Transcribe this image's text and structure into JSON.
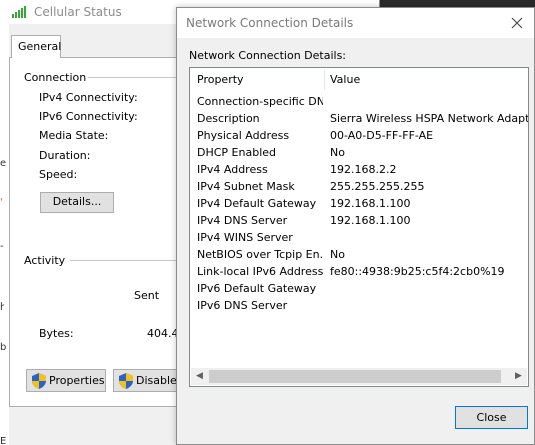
{
  "status_window": {
    "title": "Cellular Status",
    "tab": "General",
    "connection": {
      "group_label": "Connection",
      "fields": [
        "IPv4 Connectivity:",
        "IPv6 Connectivity:",
        "Media State:",
        "Duration:",
        "Speed:"
      ],
      "details_button": "Details..."
    },
    "activity": {
      "group_label": "Activity",
      "sent_label": "Sent",
      "bytes_label": "Bytes:",
      "bytes_sent": "404.4"
    },
    "properties_button": "Properties",
    "disable_button": "Disable"
  },
  "dialog": {
    "title": "Network Connection Details",
    "caption": "Network Connection Details:",
    "columns": {
      "property": "Property",
      "value": "Value"
    },
    "rows": [
      {
        "property": "Connection-specific DN...",
        "value": ""
      },
      {
        "property": "Description",
        "value": "Sierra Wireless HSPA Network Adapter #"
      },
      {
        "property": "Physical Address",
        "value": "00-A0-D5-FF-FF-AE"
      },
      {
        "property": "DHCP Enabled",
        "value": "No"
      },
      {
        "property": "IPv4 Address",
        "value": "192.168.2.2"
      },
      {
        "property": "IPv4 Subnet Mask",
        "value": "255.255.255.255"
      },
      {
        "property": "IPv4 Default Gateway",
        "value": "192.168.1.100"
      },
      {
        "property": "IPv4 DNS Server",
        "value": "192.168.1.100"
      },
      {
        "property": "IPv4 WINS Server",
        "value": ""
      },
      {
        "property": "NetBIOS over Tcpip En...",
        "value": "No"
      },
      {
        "property": "Link-local IPv6 Address",
        "value": "fe80::4938:9b25:c5f4:2cb0%19"
      },
      {
        "property": "IPv6 Default Gateway",
        "value": ""
      },
      {
        "property": "IPv6 DNS Server",
        "value": ""
      }
    ],
    "close_button": "Close"
  },
  "colors": {
    "signal": "#36a836",
    "close_border": "#0078d7",
    "shield_blue": "#2b63c4",
    "shield_yellow": "#f2c21b"
  },
  "icons": [
    "signal-bars-icon",
    "shield-icon",
    "close-icon",
    "scroll-left-icon",
    "scroll-right-icon"
  ]
}
